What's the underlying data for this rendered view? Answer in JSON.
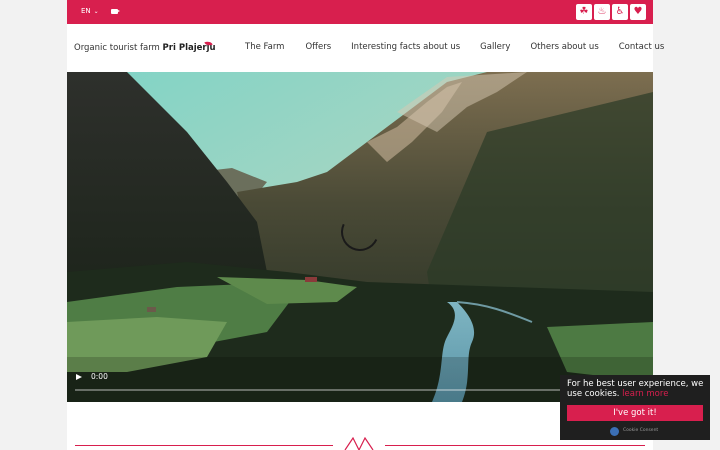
{
  "topbar": {
    "language": "EN",
    "language_caret": "⌄",
    "badges": [
      "☘",
      "♨",
      "♿",
      "♥"
    ]
  },
  "header": {
    "logo_prefix": "Organic tourist farm",
    "logo_name": "Pri Plajerju",
    "nav": [
      "The Farm",
      "Offers",
      "Interesting facts about us",
      "Gallery",
      "Others about us",
      "Contact us"
    ]
  },
  "video": {
    "time": "0:00"
  },
  "cookie": {
    "message": "For he best user experience, we use cookies.",
    "link": "learn more",
    "button": "I've got it!",
    "brand": "Cookie Consent"
  },
  "colors": {
    "accent": "#d81f4e",
    "cookie_bg": "#1f1f1f"
  }
}
